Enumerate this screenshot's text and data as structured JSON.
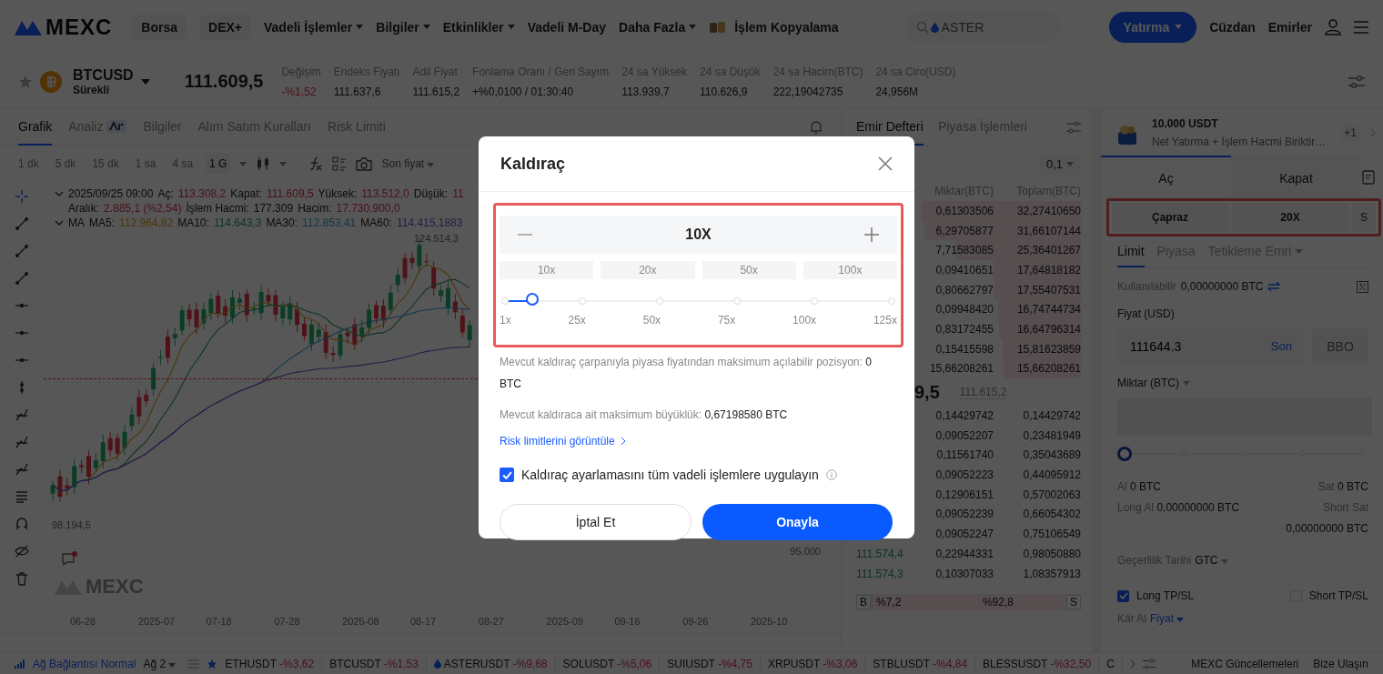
{
  "header": {
    "logo": "MEXC",
    "nav": [
      {
        "label": "Borsa",
        "kind": "pill",
        "dropdown": false
      },
      {
        "label": "DEX+",
        "kind": "pill",
        "dropdown": false
      },
      {
        "label": "Vadeli İşlemler",
        "kind": "link",
        "dropdown": true
      },
      {
        "label": "Bilgiler",
        "kind": "link",
        "dropdown": true
      },
      {
        "label": "Etkinlikler",
        "kind": "link",
        "dropdown": true
      },
      {
        "label": "Vadeli M-Day",
        "kind": "link",
        "dropdown": false
      },
      {
        "label": "Daha Fazla",
        "kind": "link",
        "dropdown": true
      },
      {
        "label": "İşlem Kopyalama",
        "kind": "featured",
        "dropdown": false
      }
    ],
    "search": {
      "placeholder": "ASTER"
    },
    "deposit_button": "Yatırma",
    "links": [
      "Cüzdan",
      "Emirler"
    ]
  },
  "ticker": {
    "symbol": "BTCUSD",
    "subtitle": "Sürekli",
    "price": "111.609,5",
    "stats": [
      {
        "label": "Değişim",
        "value": "-%1,52",
        "kind": "negative"
      },
      {
        "label": "Endeks Fiyatı",
        "value": "111.637,6",
        "kind": "plain"
      },
      {
        "label": "Adil Fiyat",
        "value": "111.615,2",
        "kind": "plain"
      },
      {
        "label": "Fonlama Oranı / Geri Sayım",
        "value": "+%0,0100 / 01:30:40",
        "kind": "plain"
      },
      {
        "label": "24 sa Yüksek",
        "value": "113.939,7",
        "kind": "plain"
      },
      {
        "label": "24 sa Düşük",
        "value": "110.626,9",
        "kind": "plain"
      },
      {
        "label": "24 sa Hacim(BTC)",
        "value": "222,19042735",
        "kind": "plain"
      },
      {
        "label": "24 sa Ciro(USD)",
        "value": "24,956M",
        "kind": "plain"
      }
    ]
  },
  "chart": {
    "tabs": [
      {
        "label": "Grafik",
        "selected": true
      },
      {
        "label": "Analiz",
        "selected": false
      },
      {
        "label": "Bilgiler",
        "selected": false
      },
      {
        "label": "Alım Satım Kuralları",
        "selected": false
      },
      {
        "label": "Risk Limiti",
        "selected": false
      }
    ],
    "timeframes": [
      {
        "label": "1 dk",
        "selected": false
      },
      {
        "label": "5 dk",
        "selected": false
      },
      {
        "label": "15 dk",
        "selected": false
      },
      {
        "label": "1 sa",
        "selected": false
      },
      {
        "label": "4 sa",
        "selected": false
      },
      {
        "label": "1 G",
        "selected": true
      }
    ],
    "price_type": "Son fiyat",
    "datetime": "2025/09/25 09:00",
    "ohlc": [
      {
        "label": "Aç:",
        "value": "113.308,2",
        "kind": "negative"
      },
      {
        "label": "Kapat:",
        "value": "111.609,5",
        "kind": "negative"
      },
      {
        "label": "Yüksek:",
        "value": "113.512,0",
        "kind": "negative"
      },
      {
        "label": "Düşük:",
        "value": "11",
        "kind": "negative"
      }
    ],
    "stats": [
      {
        "label": "Aralık:",
        "value": "2.885,1 (%2,54)",
        "kind": "negative"
      },
      {
        "label": "İşlem Hacmi:",
        "value": "177.309",
        "kind": "plain"
      },
      {
        "label": "Hacim:",
        "value": "17.730.900,0",
        "kind": "negative"
      }
    ],
    "ma_label": "MA",
    "ma": [
      {
        "label": "MA5:",
        "value": "112.964,82"
      },
      {
        "label": "MA10:",
        "value": "114.643,3"
      },
      {
        "label": "MA30:",
        "value": "112.853,41"
      },
      {
        "label": "MA60:",
        "value": "114.415,1883"
      }
    ],
    "high_marker": "124.514,3",
    "low_marker": "98.194,5",
    "axis_price": "95.000",
    "logo": "MEXC",
    "dates": [
      "06-28",
      "2025-07",
      "07-18",
      "07-28",
      "2025-08",
      "08-17",
      "08-27",
      "2025-09",
      "09-16",
      "09-26",
      "2025-10"
    ]
  },
  "order_book": {
    "tabs": [
      {
        "label": "Emir Defteri",
        "selected": true
      },
      {
        "label": "Piyasa İşlemleri",
        "selected": false
      }
    ],
    "precision": "0,1",
    "columns": [
      "Miktar(BTC)",
      "Toplam(BTC)"
    ],
    "asks": [
      {
        "amount": "0,61303506",
        "total": "32,27410650"
      },
      {
        "amount": "6,29705877",
        "total": "31,66107144"
      },
      {
        "amount": "7,71583085",
        "total": "25,36401267"
      },
      {
        "amount": "0,09410651",
        "total": "17,64818182"
      },
      {
        "amount": "0,80662797",
        "total": "17,55407531"
      },
      {
        "amount": "0,09948420",
        "total": "16,74744734"
      },
      {
        "amount": "0,83172455",
        "total": "16,64796314"
      },
      {
        "amount": "0,15415598",
        "total": "15,81623859"
      },
      {
        "amount": "15,66208261",
        "total": "15,66208261"
      }
    ],
    "mid_price": "9,5",
    "index_price": "111.615,2",
    "bids": [
      {
        "amount": "0,14429742",
        "total": "0,14429742"
      },
      {
        "amount": "0,09052207",
        "total": "0,23481949"
      },
      {
        "amount": "0,11561740",
        "total": "0,35043689"
      },
      {
        "amount": "0,09052223",
        "total": "0,44095912"
      },
      {
        "amount": "0,12906151",
        "total": "0,57002063"
      },
      {
        "amount": "0,09052239",
        "total": "0,66054302"
      },
      {
        "amount": "0,09052247",
        "total": "0,75106549"
      },
      {
        "price": "111.574,4",
        "amount": "0,22944331",
        "total": "0,98050880"
      },
      {
        "price": "111.574,3",
        "amount": "0,10307033",
        "total": "1,08357913"
      }
    ],
    "ratio": {
      "buy_label": "B",
      "buy": "%7,2",
      "sell": "%92,8",
      "sell_label": "S",
      "level": 0.072
    }
  },
  "order_panel": {
    "promo_title": "10.000 USDT",
    "promo_text": "Net Yatırma + İşlem Hacmi Biriktir…",
    "promo_count": "+1",
    "sides": [
      {
        "label": "Aç",
        "selected": true
      },
      {
        "label": "Kapat",
        "selected": false
      }
    ],
    "margin_mode": "Çapraz",
    "leverage": "20X",
    "mode_short": "S",
    "order_types": [
      {
        "label": "Limit",
        "selected": true,
        "dropdown": false
      },
      {
        "label": "Piyasa",
        "selected": false,
        "dropdown": false
      },
      {
        "label": "Tetikleme Emri",
        "selected": false,
        "dropdown": true
      }
    ],
    "available_label": "Kullanılabilir",
    "available": "0,00000000 BTC",
    "price_label": "Fiyat (USD)",
    "price_value": "111644.3",
    "price_last": "Son",
    "bbo": "BBO",
    "amount_label": "Miktar (BTC)",
    "amount_slider": {
      "level": 0
    },
    "buy_label": "Al",
    "buy_value": "0 BTC",
    "sell_label": "Sat",
    "sell_value": "0 BTC",
    "long_label": "Long Al",
    "long_value": "0,00000000 BTC",
    "short_label": "Short Sat",
    "short_value": "0,00000000 BTC",
    "validity_label": "Geçerlilik Tarihi",
    "validity": "GTC",
    "tpsl": [
      {
        "label": "Long TP/SL",
        "checked": true
      },
      {
        "label": "Short TP/SL",
        "checked": false
      }
    ],
    "take_profit_label": "Kâr Al",
    "take_profit_mode": "Fiyat"
  },
  "status_bar": {
    "network": "Ağ Bağlantısı Normal",
    "node": "Ağ 2",
    "tickers": [
      {
        "symbol": "ETHUSDT",
        "change": "-%3,62"
      },
      {
        "symbol": "BTCUSDT",
        "change": "-%1,53"
      },
      {
        "symbol": "ASTERUSDT",
        "change": "-%9,68"
      },
      {
        "symbol": "SOLUSDT",
        "change": "-%5,06"
      },
      {
        "symbol": "SUIUSDT",
        "change": "-%4,75"
      },
      {
        "symbol": "XRPUSDT",
        "change": "-%3,06"
      },
      {
        "symbol": "STBLUSDT",
        "change": "-%4,84"
      },
      {
        "symbol": "BLESSUSDT",
        "change": "-%32,50"
      },
      {
        "symbol": "C"
      }
    ],
    "updates": "MEXC Güncellemeleri",
    "contact": "Bize Ulaşın"
  },
  "modal": {
    "title": "Kaldıraç",
    "value": "10X",
    "presets": [
      "10x",
      "20x",
      "50x",
      "100x"
    ],
    "slider": {
      "level": 0.07
    },
    "ticks": [
      "1x",
      "25x",
      "50x",
      "75x",
      "100x",
      "125x"
    ],
    "info": [
      {
        "label": "Mevcut kaldıraç çarpanıyla piyasa fiyatından maksimum açılabilir pozisyon:",
        "value": "0 BTC"
      },
      {
        "label": "Mevcut kaldıraca ait maksimum büyüklük:",
        "value": "0,67198580 BTC"
      }
    ],
    "risk_link": "Risk limitlerini görüntüle",
    "apply_all": {
      "label": "Kaldıraç ayarlamasını tüm vadeli işlemlere uygulayın",
      "checked": true
    },
    "cancel": "İptal Et",
    "confirm": "Onayla"
  }
}
